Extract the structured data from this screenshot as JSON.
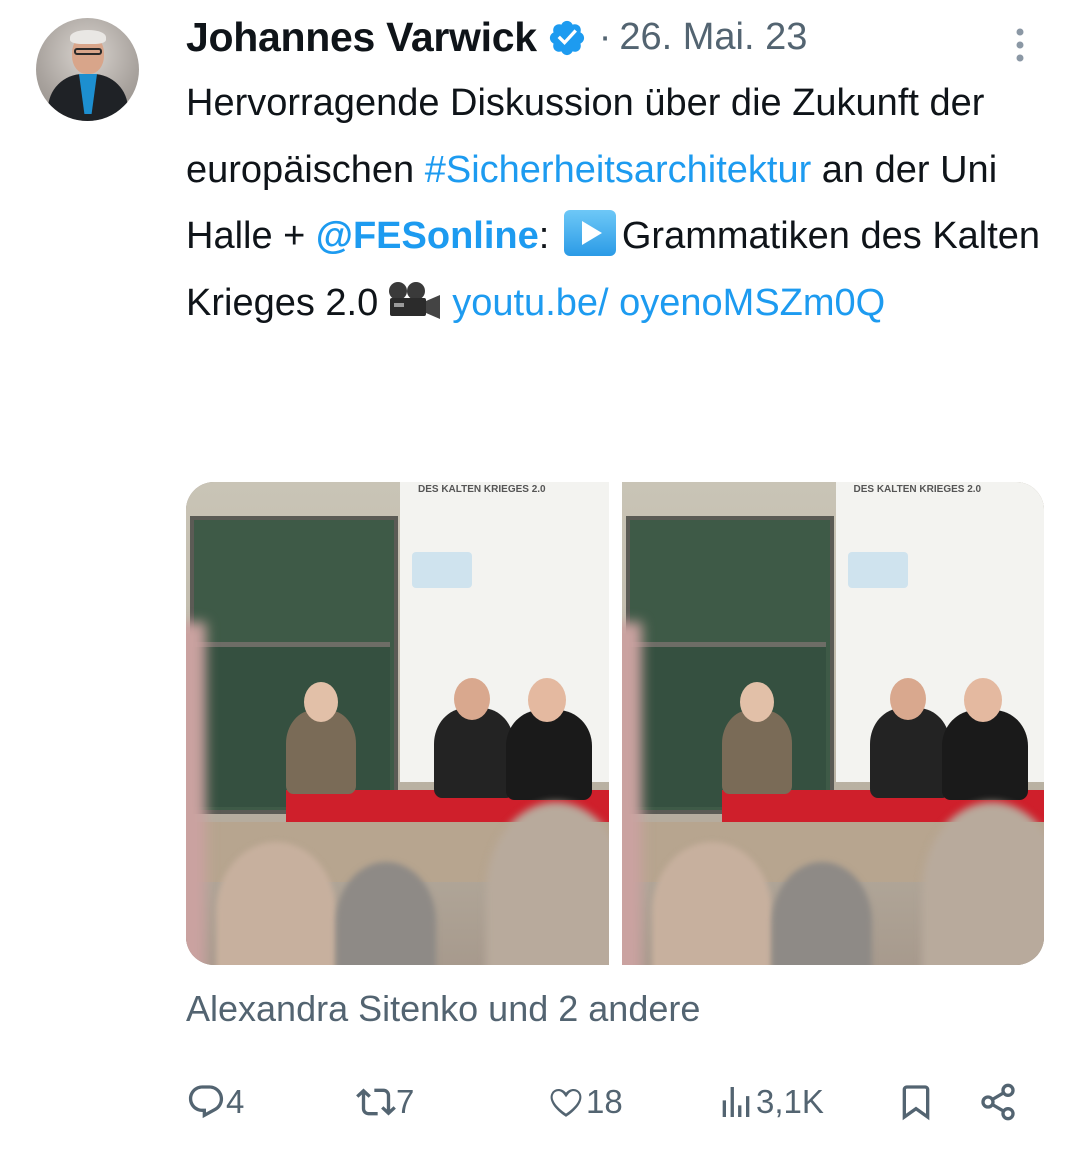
{
  "tweet": {
    "author_name": "Johannes Varwick",
    "separator": "·",
    "date": "26. Mai. 23",
    "text": {
      "p1": "Hervorragende Diskussion über die Zukunft der europäischen ",
      "hashtag": "#Sicherheitsarchitektur",
      "p2": " an der Uni Halle + ",
      "mention": "@FESonline",
      "p3": ": ",
      "p4": "Grammatiken des Kalten Krieges 2.0",
      "link": "youtu.be/ oyenoMSZm0Q"
    },
    "liked_by": "Alexandra Sitenko und 2 andere"
  },
  "photos": [
    {
      "screen_title": "DES KALTEN KRIEGES 2.0"
    },
    {
      "screen_title": "DES KALTEN KRIEGES 2.0"
    }
  ],
  "actions": {
    "replies": "4",
    "reposts": "7",
    "likes": "18",
    "views": "3,1K"
  },
  "icons": {
    "verified": "verified-badge-icon",
    "more": "more-vertical-icon",
    "reply": "reply-bubble-icon",
    "repost": "repost-arrows-icon",
    "like": "heart-icon",
    "views": "bar-chart-icon",
    "bookmark": "bookmark-icon",
    "share": "share-icon",
    "play_emoji": "play-button-emoji",
    "camera_emoji": "movie-camera-emoji"
  },
  "colors": {
    "accent": "#1d9bf0",
    "secondary_text": "#536471",
    "primary_text": "#0f1419"
  }
}
